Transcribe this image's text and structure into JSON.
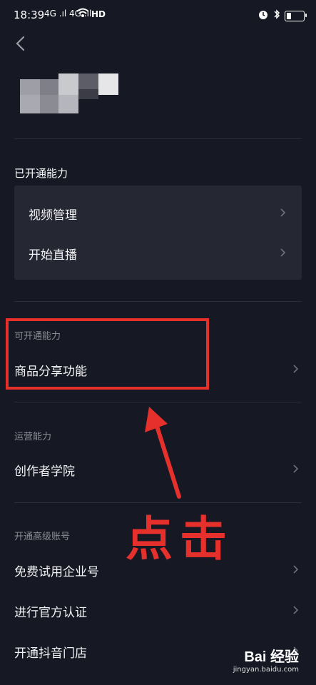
{
  "status": {
    "time": "18:39",
    "signal": "4G .ıl 4G .ıl",
    "network": "HD"
  },
  "sections": [
    {
      "title": "已开通能力",
      "items": [
        "视频管理",
        "开始直播"
      ]
    },
    {
      "title": "可开通能力",
      "items": [
        "商品分享功能"
      ]
    },
    {
      "title": "运营能力",
      "items": [
        "创作者学院"
      ]
    },
    {
      "title": "开通高级账号",
      "items": [
        "免费试用企业号",
        "进行官方认证",
        "开通抖音门店"
      ]
    }
  ],
  "annotation": {
    "text": "点击",
    "color": "#e5302c"
  },
  "watermark": {
    "logo": "Bai 经验",
    "url": "jingyan.baidu.com"
  }
}
